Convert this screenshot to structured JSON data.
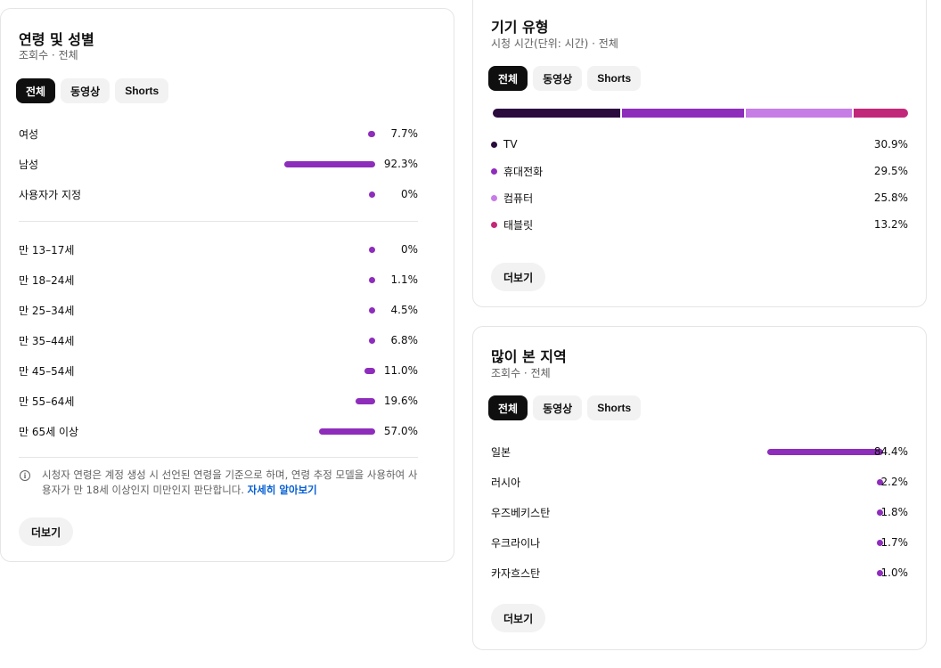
{
  "colors": {
    "bar": "#8e2dbb",
    "tv": "#2b0a3d",
    "mobile": "#8e2dbb",
    "computer": "#c77de6",
    "tablet": "#c2287a"
  },
  "age_card": {
    "title": "연령 및 성별",
    "subtitle": "조회수 · 전체",
    "chips": [
      "전체",
      "동영상",
      "Shorts"
    ],
    "gender": [
      {
        "label": "여성",
        "value": 7.7,
        "display": "7.7%"
      },
      {
        "label": "남성",
        "value": 92.3,
        "display": "92.3%"
      },
      {
        "label": "사용자가 지정",
        "value": 0,
        "display": "0%"
      }
    ],
    "ages": [
      {
        "label": "만 13–17세",
        "value": 0,
        "display": "0%"
      },
      {
        "label": "만 18–24세",
        "value": 1.1,
        "display": "1.1%"
      },
      {
        "label": "만 25–34세",
        "value": 4.5,
        "display": "4.5%"
      },
      {
        "label": "만 35–44세",
        "value": 6.8,
        "display": "6.8%"
      },
      {
        "label": "만 45–54세",
        "value": 11.0,
        "display": "11.0%"
      },
      {
        "label": "만 55–64세",
        "value": 19.6,
        "display": "19.6%"
      },
      {
        "label": "만 65세 이상",
        "value": 57.0,
        "display": "57.0%"
      }
    ],
    "note_text": "시청자 연령은 계정 생성 시 선언된 연령을 기준으로 하며, 연령 추정 모델을 사용하여 사용자가 만 18세 이상인지 미만인지 판단합니다.",
    "note_link": "자세히 알아보기",
    "more": "더보기"
  },
  "device_card": {
    "title": "기기 유형",
    "subtitle": "시청 시간(단위: 시간) · 전체",
    "chips": [
      "전체",
      "동영상",
      "Shorts"
    ],
    "items": [
      {
        "label": "TV",
        "value": 30.9,
        "display": "30.9%",
        "color_key": "tv"
      },
      {
        "label": "휴대전화",
        "value": 29.5,
        "display": "29.5%",
        "color_key": "mobile"
      },
      {
        "label": "컴퓨터",
        "value": 25.8,
        "display": "25.8%",
        "color_key": "computer"
      },
      {
        "label": "태블릿",
        "value": 13.2,
        "display": "13.2%",
        "color_key": "tablet"
      }
    ],
    "more": "더보기"
  },
  "region_card": {
    "title": "많이 본 지역",
    "subtitle": "조회수 · 전체",
    "chips": [
      "전체",
      "동영상",
      "Shorts"
    ],
    "items": [
      {
        "label": "일본",
        "value": 84.4,
        "display": "84.4%"
      },
      {
        "label": "러시아",
        "value": 2.2,
        "display": "2.2%"
      },
      {
        "label": "우즈베키스탄",
        "value": 1.8,
        "display": "1.8%"
      },
      {
        "label": "우크라이나",
        "value": 1.7,
        "display": "1.7%"
      },
      {
        "label": "카자흐스탄",
        "value": 1.0,
        "display": "1.0%"
      }
    ],
    "more": "더보기"
  }
}
